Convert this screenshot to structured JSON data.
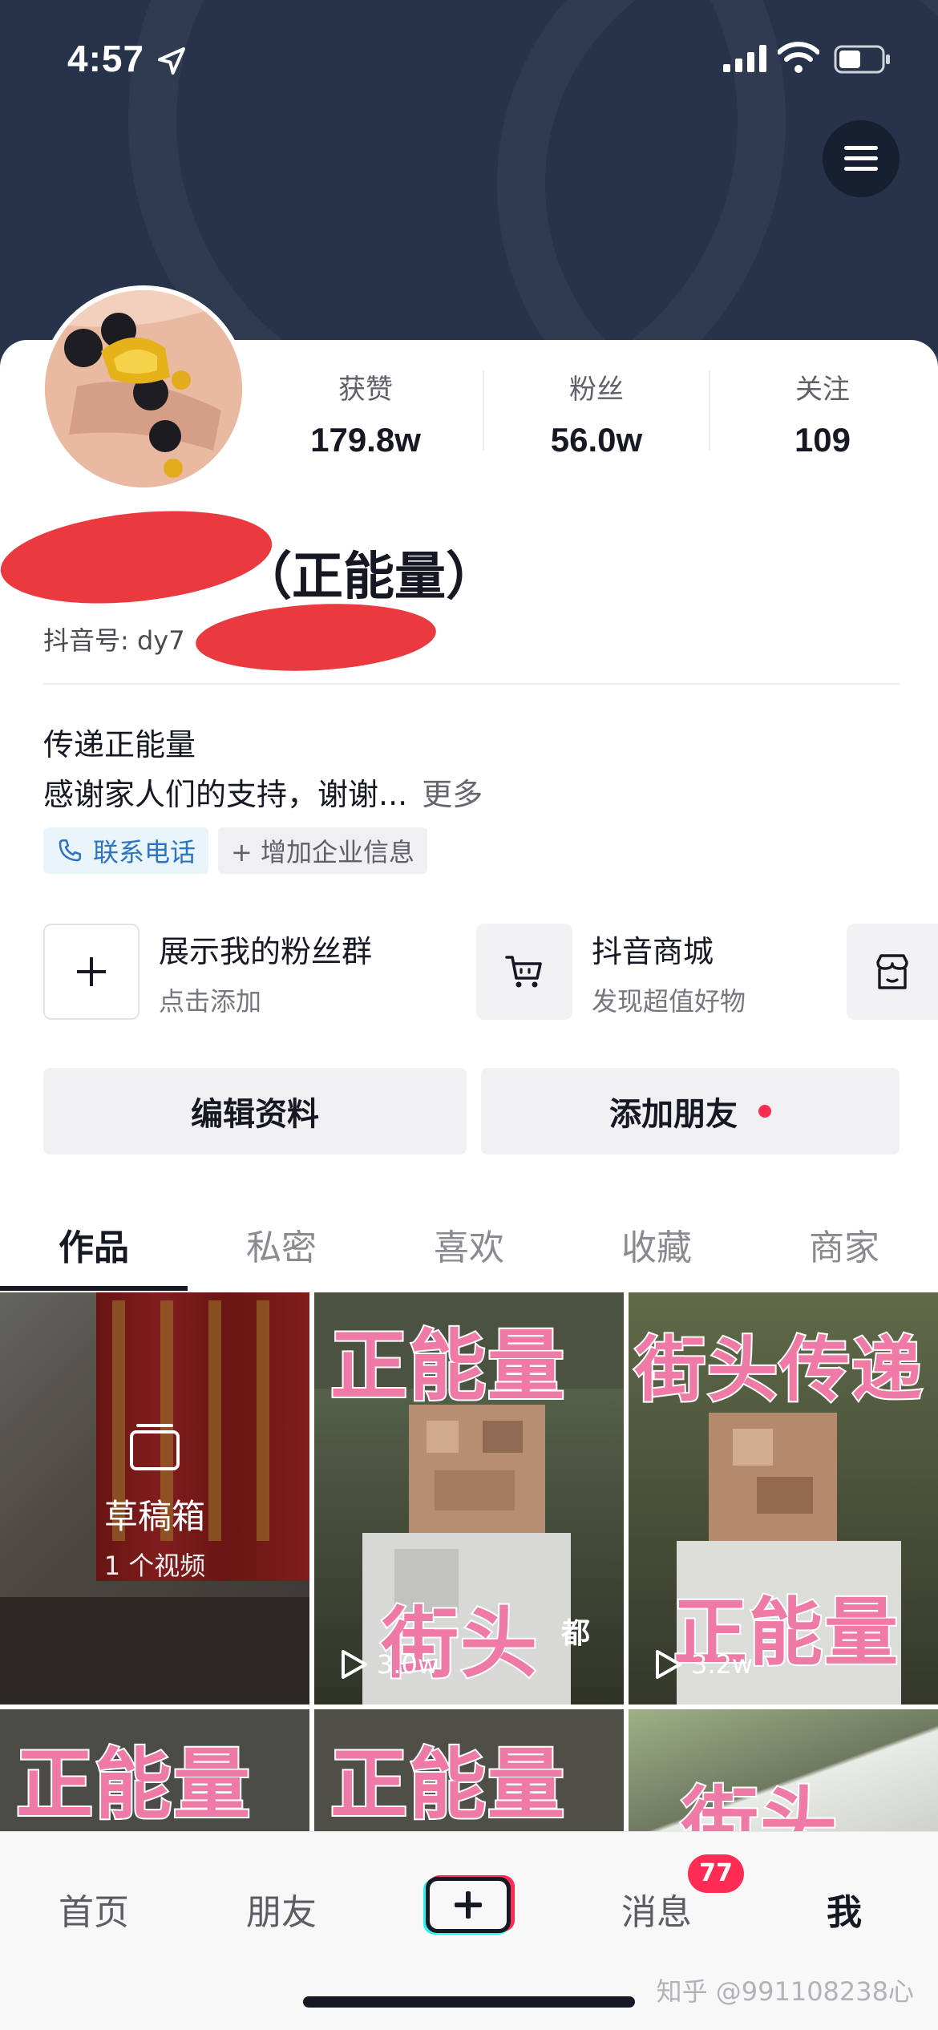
{
  "status_bar": {
    "time": "4:57"
  },
  "stats": [
    {
      "label": "获赞",
      "value": "179.8w"
    },
    {
      "label": "粉丝",
      "value": "56.0w"
    },
    {
      "label": "关注",
      "value": "109"
    }
  ],
  "profile": {
    "name_visible": "（正能量）",
    "dy_prefix": "抖音号: dy7"
  },
  "bio": {
    "line1": "传递正能量",
    "line2": "感谢家人们的支持，谢谢...",
    "more": "更多"
  },
  "tags": {
    "phone": "联系电话",
    "biz": "+ 增加企业信息"
  },
  "services": [
    {
      "title": "展示我的粉丝群",
      "sub": "点击添加",
      "icon": "plus-icon"
    },
    {
      "title": "抖音商城",
      "sub": "发现超值好物",
      "icon": "cart-icon"
    },
    {
      "title": "",
      "sub": "",
      "icon": "shop-icon"
    }
  ],
  "actions": {
    "edit": "编辑资料",
    "add_friend": "添加朋友"
  },
  "tabs": [
    "作品",
    "私密",
    "喜欢",
    "收藏",
    "商家"
  ],
  "grid": {
    "draft_title": "草稿箱",
    "draft_sub": "1 个视频",
    "items": [
      {
        "text_top": "正能量",
        "text_bottom": "街头",
        "plays": "3.0w"
      },
      {
        "text_top": "街头传递",
        "text_bottom": "正能量",
        "plays": "3.2w"
      },
      {
        "text_top": "正能量"
      },
      {
        "text_top": "正能量"
      },
      {
        "text_top": "街头"
      }
    ],
    "subtitle": "都"
  },
  "tabbar": {
    "items": [
      "首页",
      "朋友",
      "消息",
      "我"
    ],
    "badge": "77"
  },
  "watermark": "知乎 @991108238心",
  "colors": {
    "banner": "#27334b",
    "accent": "#fe2c55",
    "overlay_text": "#f07aa6"
  }
}
